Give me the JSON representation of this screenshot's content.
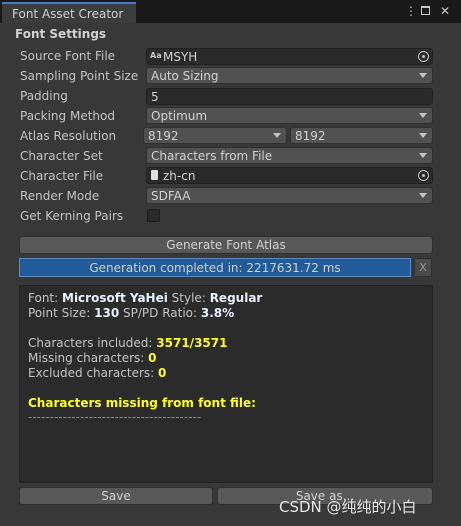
{
  "window": {
    "tab_title": "Font Asset Creator",
    "menu_icon": "more-vertical-icon",
    "maximize_icon": "maximize-icon",
    "close_icon": "close-icon",
    "menu_glyph": "⋮",
    "close_glyph": "✕"
  },
  "settings": {
    "section_title": "Font Settings",
    "source_font_file": {
      "label": "Source Font File",
      "value": "MSYH",
      "icon_glyph": "Aa"
    },
    "sampling_point_size": {
      "label": "Sampling Point Size",
      "value": "Auto Sizing"
    },
    "padding": {
      "label": "Padding",
      "value": "5"
    },
    "packing_method": {
      "label": "Packing Method",
      "value": "Optimum"
    },
    "atlas_resolution": {
      "label": "Atlas Resolution",
      "width": "8192",
      "height": "8192"
    },
    "character_set": {
      "label": "Character Set",
      "value": "Characters from File"
    },
    "character_file": {
      "label": "Character File",
      "value": "zh-cn"
    },
    "render_mode": {
      "label": "Render Mode",
      "value": "SDFAA"
    },
    "get_kerning_pairs": {
      "label": "Get Kerning Pairs",
      "checked": false
    }
  },
  "actions": {
    "generate_label": "Generate Font Atlas",
    "progress_text": "Generation completed in: 2217631.72 ms",
    "progress_value": 1.0,
    "clear_label": "X",
    "save_label": "Save",
    "save_as_label": "Save as..."
  },
  "output": {
    "font_label": "Font:",
    "font_value": "Microsoft YaHei",
    "style_label": "Style:",
    "style_value": "Regular",
    "point_size_label": "Point Size:",
    "point_size_value": "130",
    "ratio_label": "SP/PD Ratio:",
    "ratio_value": "3.8%",
    "included_label": "Characters included:",
    "included_value": "3571/3571",
    "missing_label": "Missing characters:",
    "missing_value": "0",
    "excluded_label": "Excluded characters:",
    "excluded_value": "0",
    "missing_header": "Characters missing from font file:",
    "separator": "----------------------------------------"
  },
  "watermark": "CSDN @纯纯的小白",
  "colors": {
    "accent": "#4d78cc",
    "progress_fill": "#215b99",
    "highlight_yellow": "#ffff1a",
    "highlight_white": "#e8f1ff"
  }
}
